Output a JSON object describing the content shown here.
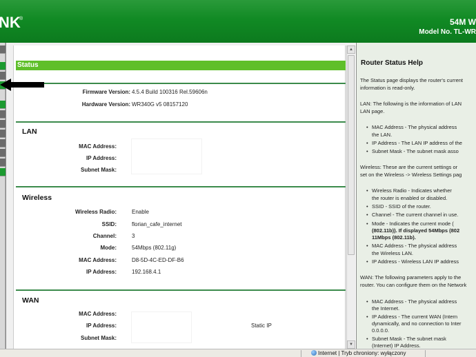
{
  "header": {
    "logo": "NK",
    "model_title": "54M W",
    "model_no": "Model No. TL-WR"
  },
  "main": {
    "status_label": "Status",
    "firmware": {
      "label": "Firmware Version:",
      "value": "4.5.4 Build 100316 Rel.59606n"
    },
    "hardware": {
      "label": "Hardware Version:",
      "value": "WR340G v5 08157120"
    },
    "lan": {
      "title": "LAN",
      "mac_label": "MAC Address:",
      "ip_label": "IP Address:",
      "mask_label": "Subnet Mask:"
    },
    "wireless": {
      "title": "Wireless",
      "radio": {
        "label": "Wireless Radio:",
        "value": "Enable"
      },
      "ssid": {
        "label": "SSID:",
        "value": "florian_cafe_internet"
      },
      "channel": {
        "label": "Channel:",
        "value": "3"
      },
      "mode": {
        "label": "Mode:",
        "value": "54Mbps (802.11g)"
      },
      "mac": {
        "label": "MAC Address:",
        "value": "D8-5D-4C-ED-DF-B6"
      },
      "ip": {
        "label": "IP Address:",
        "value": "192.168.4.1"
      }
    },
    "wan": {
      "title": "WAN",
      "mac_label": "MAC Address:",
      "ip_label": "IP Address:",
      "ip_type": "Static IP",
      "mask_label": "Subnet Mask:"
    }
  },
  "help": {
    "title": "Router Status Help",
    "lines": [
      "The Status page displays the router's current",
      "information is read-only.",
      "LAN: The following is the information of LAN",
      "LAN page."
    ],
    "lan_items": [
      "MAC Address - The physical address",
      "the LAN.",
      "IP Address - The LAN IP address of the",
      "Subnet Mask - The subnet mask asso"
    ],
    "wireless_intro": [
      "Wireless: These are the current settings or",
      "set on the Wireless -> Wireless Settings pag"
    ],
    "wireless_items": [
      "Wireless Radio - Indicates whether",
      "the router is enabled or disabled.",
      "SSID - SSID of the router.",
      "Channel - The current channel in use.",
      "Mode - Indicates the current mode (",
      "(802.11b)). If displayed 54Mbps (802",
      "11Mbps (802.11b).",
      "MAC Address - The physical address",
      "the Wireless LAN.",
      "IP Address - Wireless LAN IP address"
    ],
    "wan_intro": [
      "WAN: The following parameters apply to the",
      "router. You can configure them on the Network"
    ],
    "wan_items": [
      "MAC Address - The physical address",
      "the Internet.",
      "IP Address - The current WAN (Intern",
      "dynamically, and no connection to Inter",
      "0.0.0.0.",
      "Subnet Mask - The subnet mask",
      "(Internet) IP Address."
    ]
  },
  "statusbar": {
    "zone": "Internet | Tryb chroniony: wyłączony"
  },
  "colors": {
    "header_green": "#118a24",
    "status_bar_green": "#5fbf2a",
    "help_bg": "#e9efe6"
  }
}
